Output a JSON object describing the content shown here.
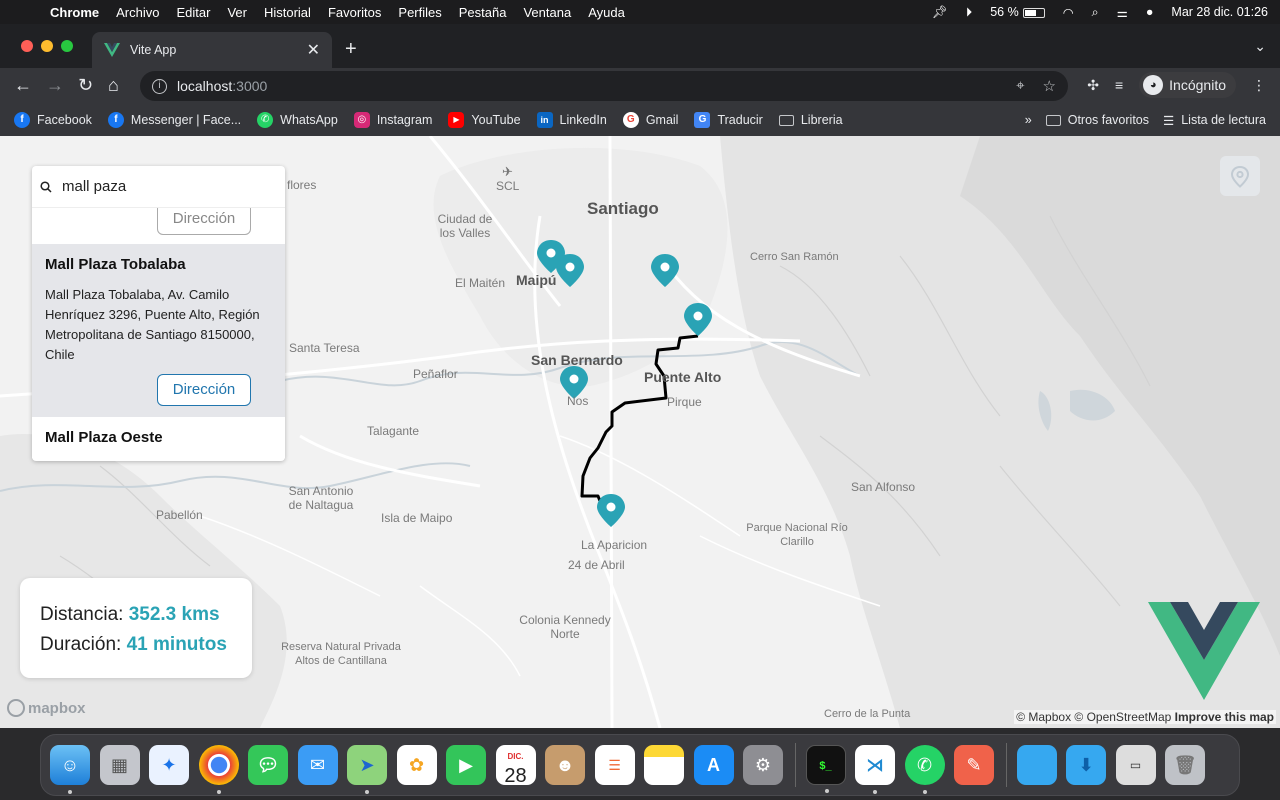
{
  "menubar": {
    "app_name": "Chrome",
    "menus": [
      "Archivo",
      "Editar",
      "Ver",
      "Historial",
      "Favoritos",
      "Perfiles",
      "Pestaña",
      "Ventana",
      "Ayuda"
    ],
    "battery": "56 %",
    "datetime": "Mar 28 dic.  01:26"
  },
  "browser": {
    "tab_title": "Vite App",
    "url_host": "localhost",
    "url_port": ":3000",
    "profile_label": "Incógnito",
    "bookmarks": [
      {
        "label": "Facebook",
        "color": "#1877f2",
        "glyph": "f"
      },
      {
        "label": "Messenger | Face...",
        "color": "#1877f2",
        "glyph": "f"
      },
      {
        "label": "WhatsApp",
        "color": "#25d366",
        "glyph": "w"
      },
      {
        "label": "Instagram",
        "color": "#d62976",
        "glyph": "◎"
      },
      {
        "label": "YouTube",
        "color": "#ff0000",
        "glyph": "▶"
      },
      {
        "label": "LinkedIn",
        "color": "#0a66c2",
        "glyph": "in"
      },
      {
        "label": "Gmail",
        "color": "#ea4335",
        "glyph": "G"
      },
      {
        "label": "Traducir",
        "color": "#4285f4",
        "glyph": "G"
      },
      {
        "label": "Libreria",
        "color": "folder",
        "glyph": ""
      }
    ],
    "overflow": "»",
    "other_bookmarks": "Otros favoritos",
    "reading_list": "Lista de lectura"
  },
  "search": {
    "query": "mall paza",
    "results": [
      {
        "direction_label": "Dirección"
      },
      {
        "name": "Mall Plaza Tobalaba",
        "address": "Mall Plaza Tobalaba, Av. Camilo Henríquez 3296, Puente Alto, Región Metropolitana de Santiago 8150000, Chile",
        "direction_label": "Dirección"
      },
      {
        "name": "Mall Plaza Oeste"
      }
    ]
  },
  "trip": {
    "distance_label": "Distancia:",
    "distance_value": "352.3 kms",
    "duration_label": "Duración:",
    "duration_value": "41 minutos"
  },
  "map": {
    "places": [
      {
        "name": "SCL"
      },
      {
        "name": "Ciudad de los Valles"
      },
      {
        "name": "Santiago"
      },
      {
        "name": "Cerro San Ramón"
      },
      {
        "name": "El Maitén"
      },
      {
        "name": "Maipú"
      },
      {
        "name": "Santa Teresa"
      },
      {
        "name": "San Bernardo"
      },
      {
        "name": "Puente Alto"
      },
      {
        "name": "Peñaflor"
      },
      {
        "name": "Nos"
      },
      {
        "name": "Pirque"
      },
      {
        "name": "Talagante"
      },
      {
        "name": "San Antonio de Naltagua"
      },
      {
        "name": "Isla de Maipo"
      },
      {
        "name": "San Alfonso"
      },
      {
        "name": "Pabellón"
      },
      {
        "name": "La Aparicion"
      },
      {
        "name": "24 de Abril"
      },
      {
        "name": "Parque Nacional Río Clarillo"
      },
      {
        "name": "Colonia Kennedy Norte"
      },
      {
        "name": "Reserva Natural Privada Altos de Cantillana"
      },
      {
        "name": "Cerro de la Punta"
      },
      {
        "name": "flores"
      }
    ],
    "mapbox_label": "mapbox",
    "attribution": "© Mapbox © OpenStreetMap",
    "improve": "Improve this map",
    "marker_color": "#2aa3b5"
  },
  "dock": {
    "apps": [
      "finder",
      "launchpad",
      "safari",
      "chrome",
      "messages",
      "mail",
      "maps",
      "photos",
      "facetime",
      "calendar",
      "contacts",
      "reminders",
      "notes",
      "app-store",
      "system-preferences",
      "terminal",
      "vscode",
      "whatsapp",
      "pencil-app",
      "folder",
      "downloads",
      "screenshot",
      "trash"
    ],
    "calendar_month": "DIC.",
    "calendar_day": "28"
  }
}
